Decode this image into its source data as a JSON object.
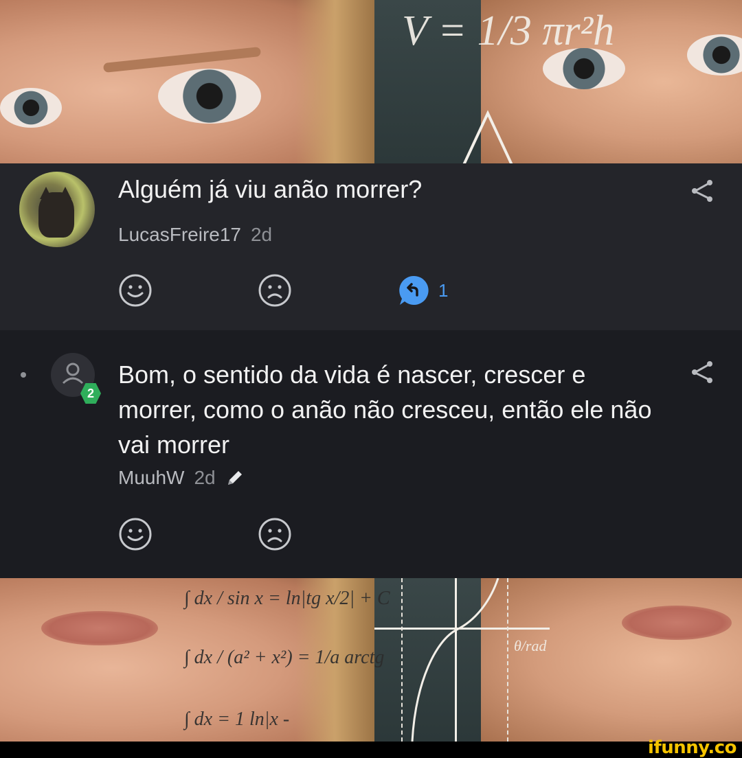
{
  "post": {
    "title": "Alguém já viu anão morrer?",
    "author": "LucasFreire17",
    "time": "2d",
    "reply_count": "1"
  },
  "reply": {
    "text": "Bom, o sentido da vida é nascer, crescer e morrer, como o anão não cresceu, então ele não vai morrer",
    "author": "MuuhW",
    "time": "2d",
    "level": "2"
  },
  "meme": {
    "top_formula": "V = 1/3 πr²h",
    "bottom_formula_1": "∫ dx / sin x = ln|tg x/2| + C",
    "bottom_formula_2": "∫ dx / (a² + x²) = 1/a arctg",
    "bottom_formula_3": "∫ dx = 1 ln|x -",
    "graph_label": "θ/rad"
  },
  "watermark": "ifunny.co",
  "colors": {
    "accent_blue": "#4a9bf2",
    "badge_green": "#2fae5b",
    "post_bg": "#24252a",
    "reply_bg": "#1b1c21",
    "watermark": "#f6c400"
  },
  "icons": [
    "smile-icon",
    "sad-icon",
    "reply-icon",
    "share-icon",
    "pencil-icon",
    "user-icon"
  ]
}
